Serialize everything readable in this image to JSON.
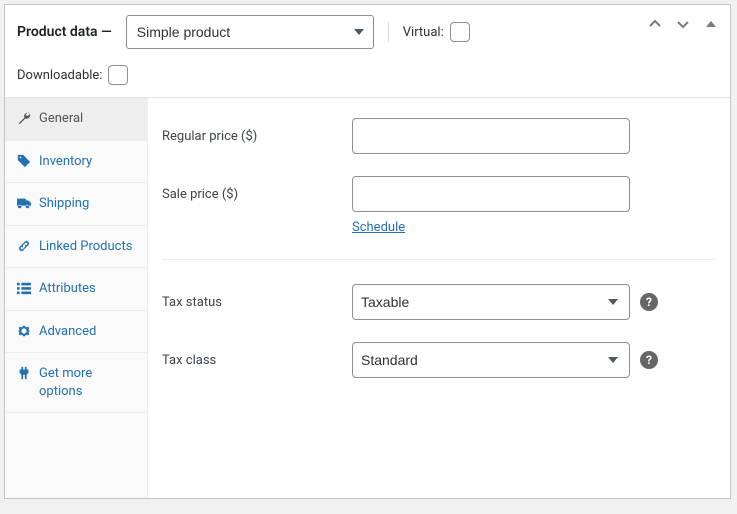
{
  "header": {
    "title": "Product data —",
    "product_type": "Simple product",
    "virtual_label": "Virtual:",
    "downloadable_label": "Downloadable:"
  },
  "sidebar": {
    "items": [
      {
        "label": "General",
        "icon": "wrench"
      },
      {
        "label": "Inventory",
        "icon": "tag"
      },
      {
        "label": "Shipping",
        "icon": "truck"
      },
      {
        "label": "Linked Products",
        "icon": "link"
      },
      {
        "label": "Attributes",
        "icon": "list"
      },
      {
        "label": "Advanced",
        "icon": "gear"
      },
      {
        "label": "Get more options",
        "icon": "plugin"
      }
    ]
  },
  "fields": {
    "regular_price_label": "Regular price ($)",
    "regular_price_value": "",
    "sale_price_label": "Sale price ($)",
    "sale_price_value": "",
    "schedule_label": "Schedule",
    "tax_status_label": "Tax status",
    "tax_status_value": "Taxable",
    "tax_class_label": "Tax class",
    "tax_class_value": "Standard"
  }
}
